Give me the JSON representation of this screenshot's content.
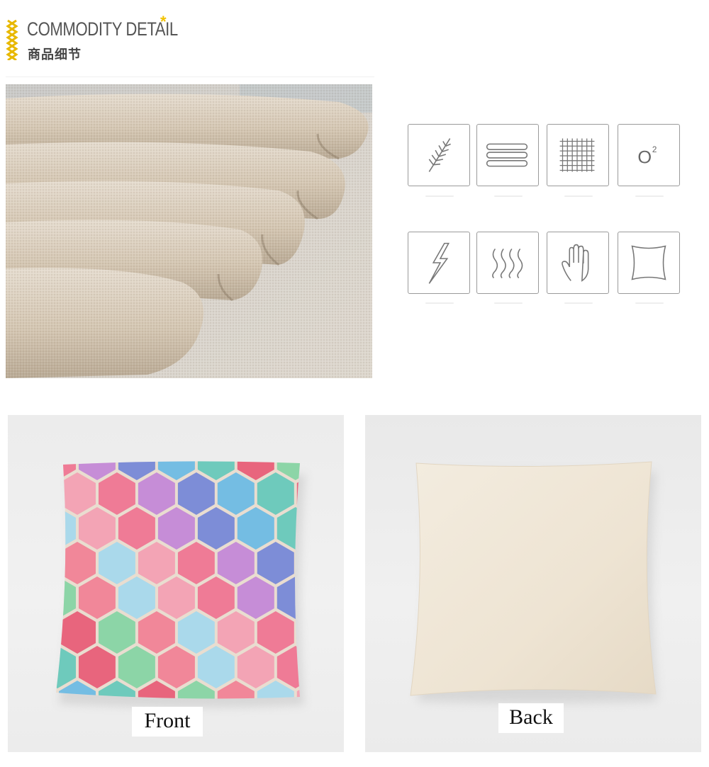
{
  "header": {
    "title_en": "COMMODITY DETAIL",
    "title_star": "*",
    "title_cn": "商品细节"
  },
  "features": [
    {
      "icon": "fern-leaf-icon"
    },
    {
      "icon": "layered-fabric-icon"
    },
    {
      "icon": "woven-grid-icon"
    },
    {
      "icon": "oxygen-icon",
      "text": "O²"
    },
    {
      "icon": "lightning-icon"
    },
    {
      "icon": "heat-waves-icon"
    },
    {
      "icon": "hand-icon"
    },
    {
      "icon": "pillow-outline-icon"
    }
  ],
  "gallery": {
    "front_label": "Front",
    "back_label": "Back"
  },
  "colors": {
    "accent": "#f2c200",
    "linen": "#d8cbb8",
    "pillow_back": "#efe6d6"
  }
}
